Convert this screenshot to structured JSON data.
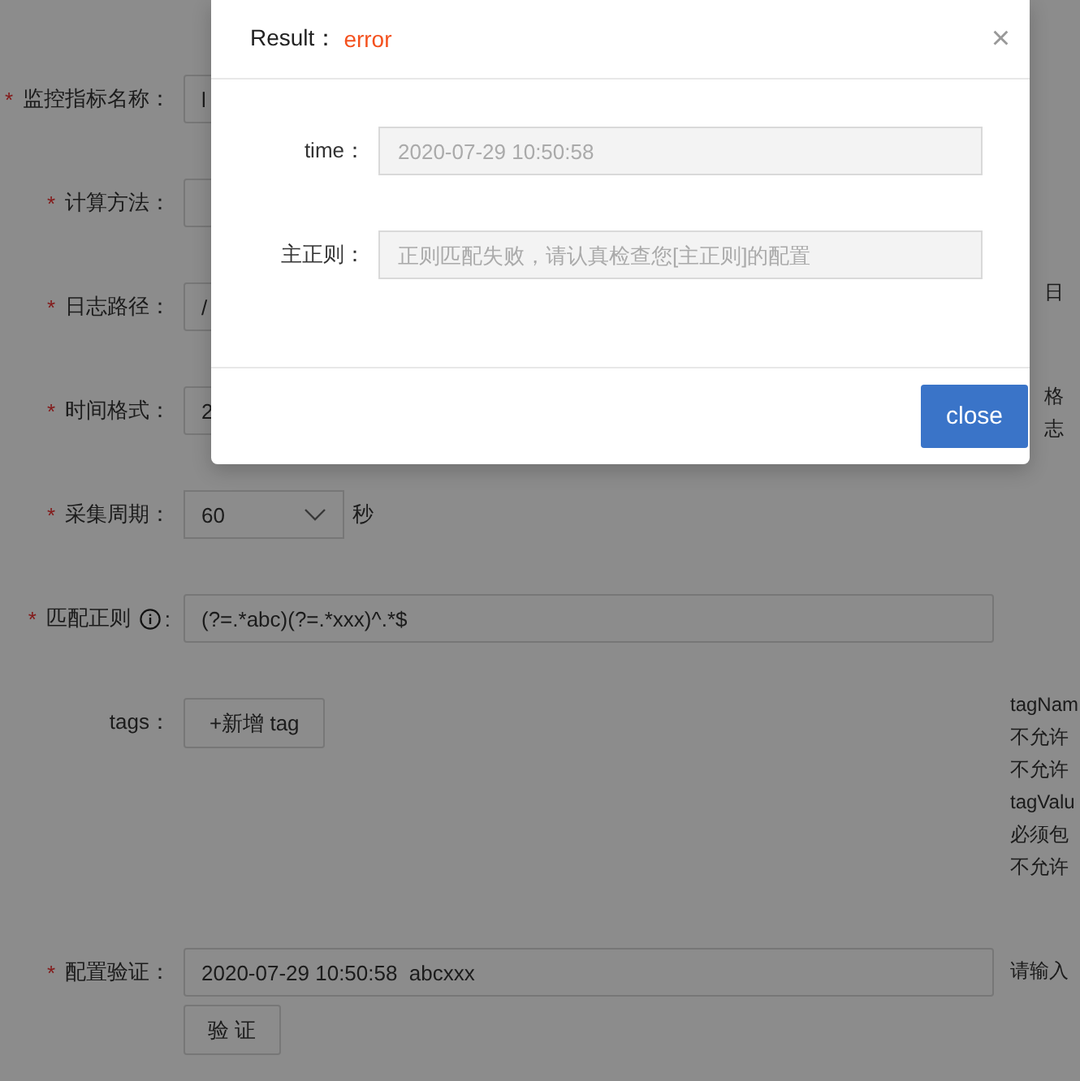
{
  "form": {
    "rows": [
      {
        "kind": "input",
        "mark": "*",
        "label": "监控指标名称：",
        "value": "l"
      },
      {
        "kind": "input",
        "mark": "*",
        "label": "计算方法："
      },
      {
        "kind": "input",
        "mark": "*",
        "label": "日志路径：",
        "value": "/",
        "hints": [
          "日"
        ]
      },
      {
        "kind": "input",
        "mark": "*",
        "label": "时间格式：",
        "value": "2",
        "hints": [
          "格",
          "志"
        ]
      },
      {
        "kind": "select",
        "mark": "*",
        "label": "采集周期：",
        "value": "60",
        "unit": "秒"
      },
      {
        "kind": "regex",
        "mark": "*",
        "label": "匹配正则",
        "info": true,
        "colon": ":",
        "value": "(?=.*abc)(?=.*xxx)^.*$"
      },
      {
        "kind": "tags",
        "label": "tags：",
        "button": "+新增 tag",
        "hints": [
          "tagNam",
          "不允许",
          "不允许",
          "tagValu",
          "必须包",
          "不允许"
        ]
      },
      {
        "kind": "verify",
        "mark": "*",
        "label": "配置验证：",
        "value": "2020-07-29 10:50:58  abcxxx",
        "hints": [
          "请输入"
        ],
        "button": "验 证"
      }
    ]
  },
  "modal": {
    "title": "Result：",
    "status": "error",
    "fields": [
      {
        "label": "time：",
        "value": "2020-07-29 10:50:58"
      },
      {
        "label": "主正则：",
        "placeholder": "正则匹配失败，请认真检查您[主正则]的配置"
      }
    ],
    "close_icon": "×",
    "button": "close"
  }
}
